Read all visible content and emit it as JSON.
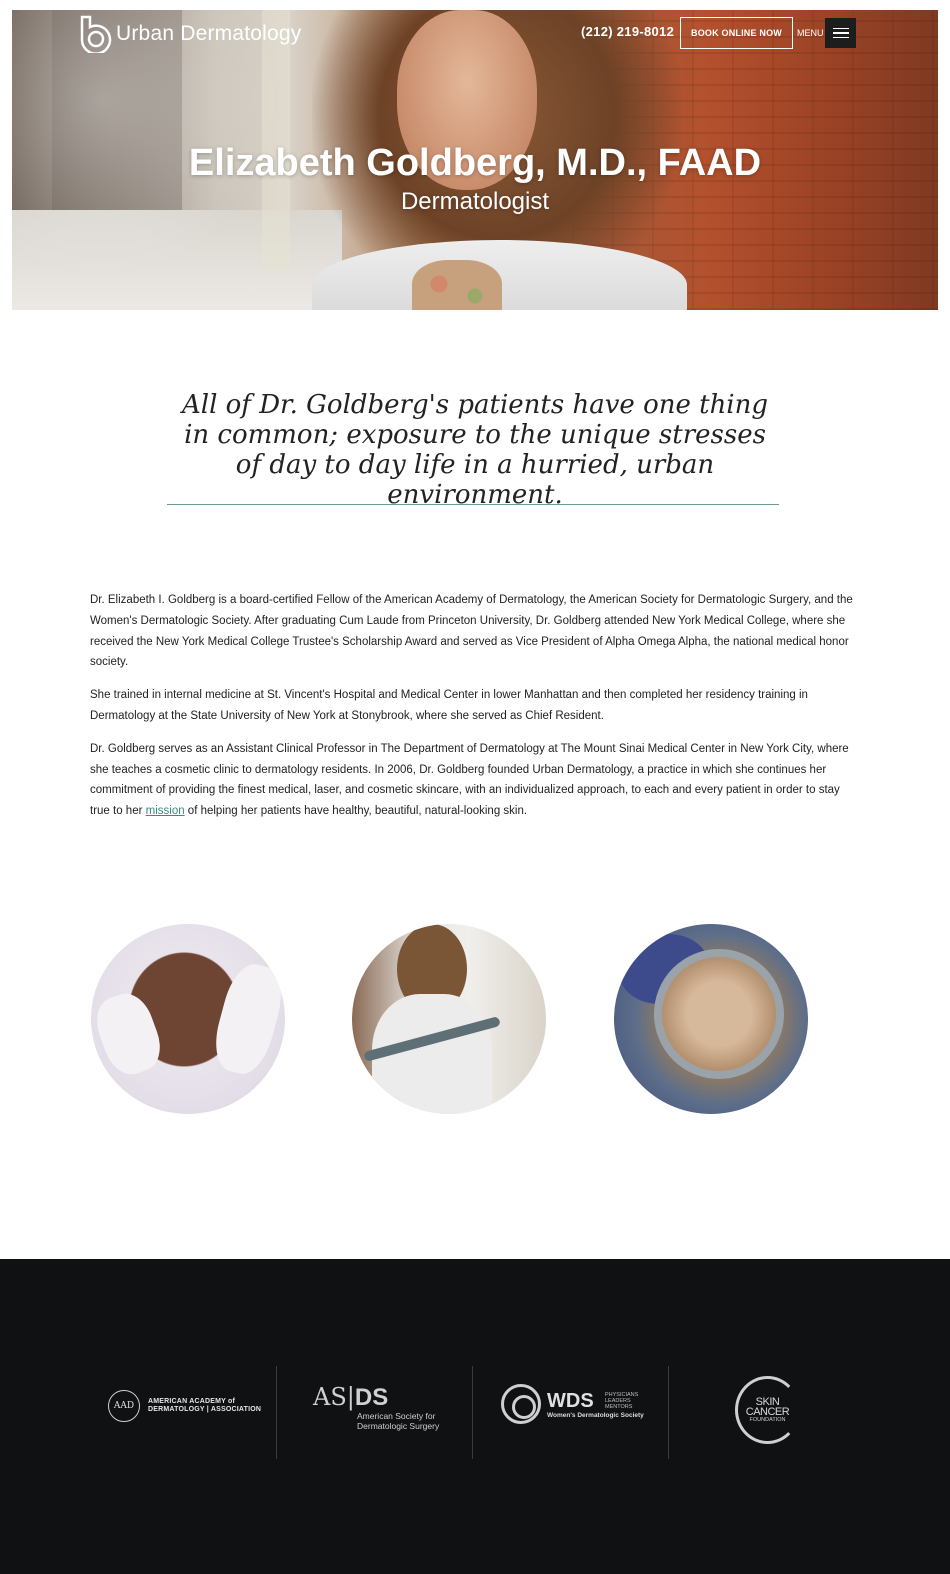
{
  "header": {
    "logo_text": "Urban Dermatology",
    "phone": "(212) 219-8012",
    "book_label": "BOOK ONLINE NOW",
    "menu_label": "MENU"
  },
  "hero": {
    "title": "Elizabeth Goldberg, M.D., FAAD",
    "subtitle": "Dermatologist"
  },
  "quote": "All of Dr. Goldberg's patients have one thing in common; exposure to the unique stresses of day to day life in a hurried, urban environment.",
  "bio": {
    "p1": "Dr. Elizabeth I. Goldberg is a board-certified Fellow of the American Academy of Dermatology, the American Society for Dermatologic Surgery, and the Women's Dermatologic Society. After graduating Cum Laude from Princeton University, Dr. Goldberg attended New York Medical College, where she received the New York Medical College Trustee's Scholarship Award and served as Vice President of Alpha Omega Alpha, the national medical honor society.",
    "p2": "She trained in internal medicine at St. Vincent's Hospital and Medical Center in lower Manhattan and then completed her residency training in Dermatology at the State University of New York at Stonybrook, where she served as Chief Resident.",
    "p3_before": "Dr. Goldberg serves as an Assistant Clinical Professor in The Department of Dermatology at The Mount Sinai Medical Center in New York City, where she teaches a cosmetic clinic to dermatology residents. In 2006, Dr. Goldberg founded Urban Dermatology, a practice in which she continues her commitment of providing the finest medical, laser, and cosmetic skincare, with an individualized approach, to each and every patient in order to stay true to her ",
    "p3_link": "mission",
    "p3_after": " of helping her patients have healthy, beautiful, natural-looking skin."
  },
  "footer": {
    "aad": {
      "seal": "AAD",
      "line1": "AMERICAN ACADEMY of",
      "line2": "DERMATOLOGY | ASSOCIATION"
    },
    "asds": {
      "big_left": "AS",
      "big_right": "DS",
      "line1": "American Society for",
      "line2": "Dermatologic Surgery"
    },
    "wds": {
      "big": "WDS",
      "tag1": "PHYSICIANS",
      "tag2": "LEADERS",
      "tag3": "MENTORS",
      "name": "Women's Dermatologic Society"
    },
    "scf": {
      "line1": "SKIN",
      "line2": "CANCER",
      "line3": "FOUNDATION"
    }
  },
  "colors": {
    "accent": "#3e8a7e",
    "footer_bg": "#0f1113"
  }
}
